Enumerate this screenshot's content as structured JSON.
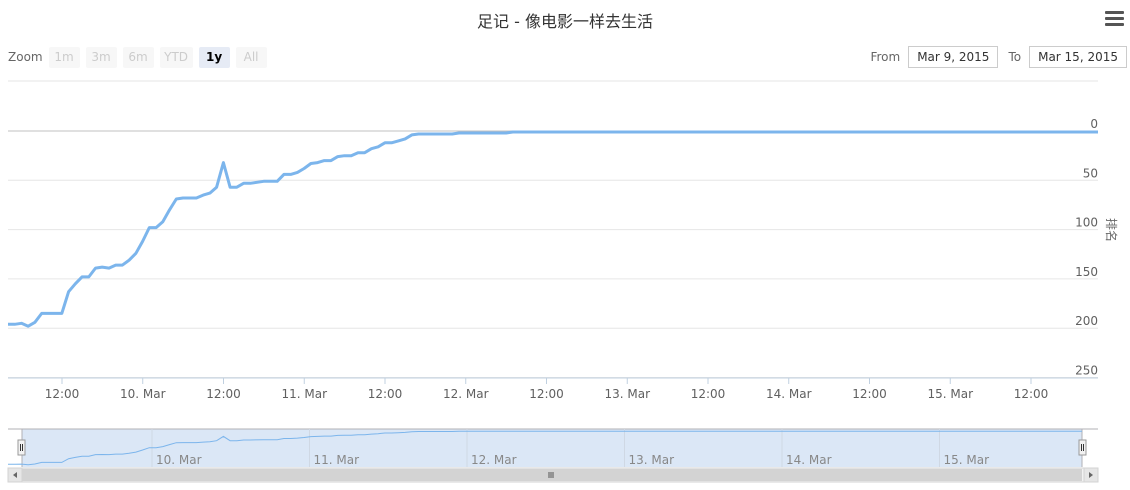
{
  "title": "足记 - 像电影一样去生活",
  "menu_icon": "hamburger-menu-icon",
  "zoom": {
    "label": "Zoom",
    "buttons": [
      {
        "label": "1m",
        "active": false
      },
      {
        "label": "3m",
        "active": false
      },
      {
        "label": "6m",
        "active": false
      },
      {
        "label": "YTD",
        "active": false
      },
      {
        "label": "1y",
        "active": true
      },
      {
        "label": "All",
        "active": false
      }
    ]
  },
  "range": {
    "from_label": "From",
    "from_value": "Mar 9, 2015",
    "to_label": "To",
    "to_value": "Mar 15, 2015"
  },
  "colors": {
    "series": "#7cb5ec",
    "grid": "#e6e6e6",
    "navigator_fill": "#dbe7f6",
    "scrollbar": "#d3d3d3"
  },
  "chart_data": {
    "type": "line",
    "title": "足记 - 像电影一样去生活",
    "ylabel": "排名",
    "y_reversed": true,
    "ylim": [
      0,
      250
    ],
    "yticks": [
      "0",
      "50",
      "100",
      "150",
      "200",
      "250"
    ],
    "xticks": [
      "12:00",
      "10. Mar",
      "12:00",
      "11. Mar",
      "12:00",
      "12. Mar",
      "12:00",
      "13. Mar",
      "12:00",
      "14. Mar",
      "12:00",
      "15. Mar",
      "12:00"
    ],
    "navigator_labels": [
      "10. Mar",
      "11. Mar",
      "12. Mar",
      "13. Mar",
      "14. Mar",
      "15. Mar"
    ],
    "series": [
      {
        "points": [
          [
            "Mar 9 06:00",
            196
          ],
          [
            "Mar 9 07:00",
            196
          ],
          [
            "Mar 9 08:00",
            195
          ],
          [
            "Mar 9 09:00",
            198
          ],
          [
            "Mar 9 10:00",
            194
          ],
          [
            "Mar 9 11:00",
            185
          ],
          [
            "Mar 9 13:00",
            185
          ],
          [
            "Mar 9 14:00",
            185
          ],
          [
            "Mar 9 15:00",
            163
          ],
          [
            "Mar 9 16:00",
            155
          ],
          [
            "Mar 9 17:00",
            148
          ],
          [
            "Mar 9 18:00",
            148
          ],
          [
            "Mar 9 19:00",
            139
          ],
          [
            "Mar 9 20:00",
            138
          ],
          [
            "Mar 9 21:00",
            139
          ],
          [
            "Mar 9 22:00",
            136
          ],
          [
            "Mar 9 23:00",
            136
          ],
          [
            "Mar 10 00:00",
            131
          ],
          [
            "Mar 10 01:00",
            124
          ],
          [
            "Mar 10 02:00",
            112
          ],
          [
            "Mar 10 03:00",
            98
          ],
          [
            "Mar 10 04:00",
            98
          ],
          [
            "Mar 10 05:00",
            92
          ],
          [
            "Mar 10 06:00",
            80
          ],
          [
            "Mar 10 07:00",
            69
          ],
          [
            "Mar 10 08:00",
            68
          ],
          [
            "Mar 10 10:00",
            68
          ],
          [
            "Mar 10 11:00",
            65
          ],
          [
            "Mar 10 12:00",
            63
          ],
          [
            "Mar 10 13:00",
            57
          ],
          [
            "Mar 10 14:00",
            32
          ],
          [
            "Mar 10 15:00",
            57
          ],
          [
            "Mar 10 16:00",
            57
          ],
          [
            "Mar 10 17:00",
            53
          ],
          [
            "Mar 10 18:00",
            53
          ],
          [
            "Mar 10 20:00",
            51
          ],
          [
            "Mar 10 22:00",
            51
          ],
          [
            "Mar 10 23:00",
            44
          ],
          [
            "Mar 11 00:00",
            44
          ],
          [
            "Mar 11 01:00",
            42
          ],
          [
            "Mar 11 02:00",
            38
          ],
          [
            "Mar 11 03:00",
            33
          ],
          [
            "Mar 11 04:00",
            32
          ],
          [
            "Mar 11 05:00",
            30
          ],
          [
            "Mar 11 06:00",
            30
          ],
          [
            "Mar 11 07:00",
            26
          ],
          [
            "Mar 11 08:00",
            25
          ],
          [
            "Mar 11 09:00",
            25
          ],
          [
            "Mar 11 10:00",
            22
          ],
          [
            "Mar 11 11:00",
            22
          ],
          [
            "Mar 11 12:00",
            18
          ],
          [
            "Mar 11 13:00",
            16
          ],
          [
            "Mar 11 14:00",
            12
          ],
          [
            "Mar 11 15:00",
            12
          ],
          [
            "Mar 11 16:00",
            10
          ],
          [
            "Mar 11 17:00",
            8
          ],
          [
            "Mar 11 18:00",
            4
          ],
          [
            "Mar 11 19:00",
            3
          ],
          [
            "Mar 12 00:00",
            3
          ],
          [
            "Mar 12 01:00",
            2
          ],
          [
            "Mar 12 08:00",
            2
          ],
          [
            "Mar 12 09:00",
            1
          ],
          [
            "Mar 13 08:00",
            1
          ]
        ]
      }
    ]
  }
}
